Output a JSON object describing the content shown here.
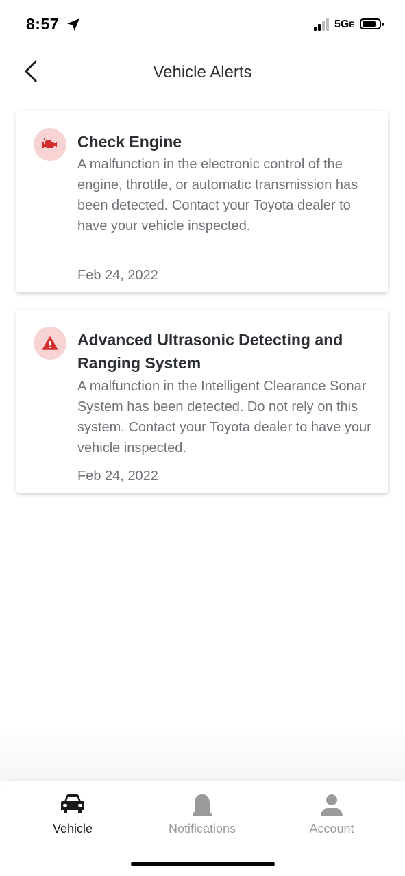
{
  "status_bar": {
    "time": "8:57",
    "network": "5G",
    "network_suffix": "E"
  },
  "header": {
    "title": "Vehicle Alerts",
    "back_icon": "chevron-left-icon"
  },
  "alerts": [
    {
      "icon": "check-engine-icon",
      "title": "Check Engine",
      "description": "A malfunction in the electronic control of the engine, throttle, or automatic transmission has been detected. Contact your Toyota dealer to have your vehicle inspected.",
      "date": "Feb 24, 2022"
    },
    {
      "icon": "warning-triangle-icon",
      "title": "Advanced Ultrasonic Detecting and Ranging System",
      "description": "A malfunction in the Intelligent Clearance Sonar System has been detected. Do not rely on this system. Contact your Toyota dealer to have your vehicle inspected.",
      "date": "Feb 24, 2022"
    }
  ],
  "tab_bar": {
    "tabs": [
      {
        "label": "Vehicle",
        "icon": "car-icon",
        "active": true
      },
      {
        "label": "Notifications",
        "icon": "bell-icon",
        "active": false
      },
      {
        "label": "Account",
        "icon": "person-icon",
        "active": false
      }
    ]
  },
  "colors": {
    "alert_red": "#d32f2f",
    "alert_icon_bg": "#f7d3d3",
    "text_dark": "#2b2f33",
    "text_muted": "#6f7277",
    "tab_inactive": "#9a9a9a"
  }
}
